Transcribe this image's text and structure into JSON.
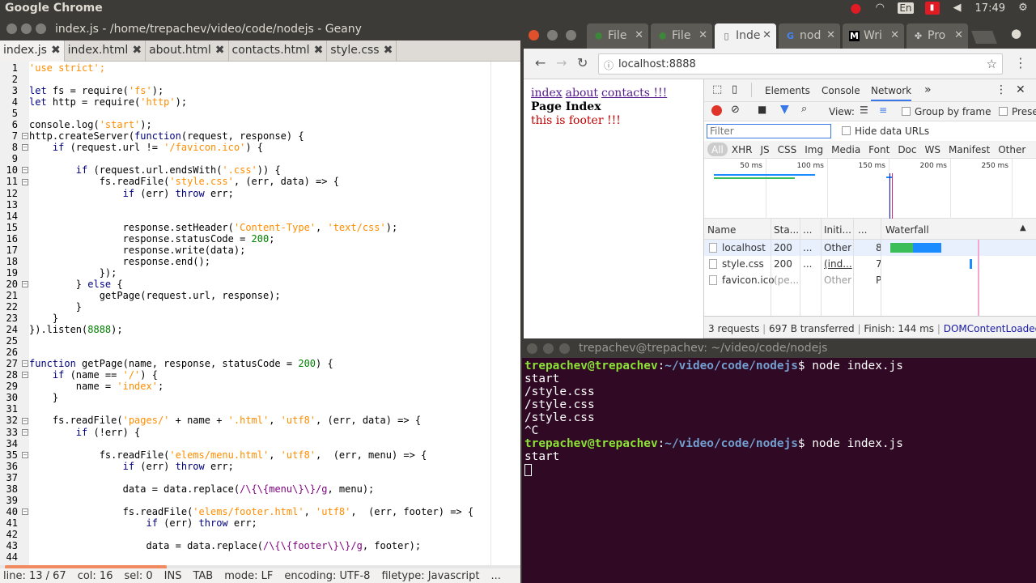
{
  "topbar": {
    "app_title": "Google Chrome",
    "lang": "En",
    "time": "17:49"
  },
  "geany": {
    "title": "index.js - /home/trepachev/video/code/nodejs - Geany",
    "tabs": [
      {
        "label": "index.js"
      },
      {
        "label": "index.html"
      },
      {
        "label": "about.html"
      },
      {
        "label": "contacts.html"
      },
      {
        "label": "style.css"
      }
    ],
    "code_lines": [
      [
        [
          "s",
          "'use strict';"
        ]
      ],
      [],
      [
        [
          "k",
          "let"
        ],
        [
          "t",
          " fs = require("
        ],
        [
          "s",
          "'fs'"
        ],
        [
          "t",
          ");"
        ]
      ],
      [
        [
          "k",
          "let"
        ],
        [
          "t",
          " http = require("
        ],
        [
          "s",
          "'http'"
        ],
        [
          "t",
          ");"
        ]
      ],
      [],
      [
        [
          "t",
          "console.log("
        ],
        [
          "s",
          "'start'"
        ],
        [
          "t",
          ");"
        ]
      ],
      [
        [
          "t",
          "http.createServer("
        ],
        [
          "k",
          "function"
        ],
        [
          "t",
          "(request, response) {"
        ]
      ],
      [
        [
          "t",
          "    "
        ],
        [
          "k",
          "if"
        ],
        [
          "t",
          " (request.url != "
        ],
        [
          "s",
          "'/favicon.ico'"
        ],
        [
          "t",
          ") {"
        ]
      ],
      [],
      [
        [
          "t",
          "        "
        ],
        [
          "k",
          "if"
        ],
        [
          "t",
          " (request.url.endsWith("
        ],
        [
          "s",
          "'.css'"
        ],
        [
          "t",
          ")) {"
        ]
      ],
      [
        [
          "t",
          "            fs.readFile("
        ],
        [
          "s",
          "'style.css'"
        ],
        [
          "t",
          ", (err, data) => {"
        ]
      ],
      [
        [
          "t",
          "                "
        ],
        [
          "k",
          "if"
        ],
        [
          "t",
          " (err) "
        ],
        [
          "k",
          "throw"
        ],
        [
          "t",
          " err;"
        ]
      ],
      [],
      [],
      [
        [
          "t",
          "                response.setHeader("
        ],
        [
          "s",
          "'Content-Type'"
        ],
        [
          "t",
          ", "
        ],
        [
          "s",
          "'text/css'"
        ],
        [
          "t",
          ");"
        ]
      ],
      [
        [
          "t",
          "                response.statusCode = "
        ],
        [
          "n",
          "200"
        ],
        [
          "t",
          ";"
        ]
      ],
      [
        [
          "t",
          "                response.write(data);"
        ]
      ],
      [
        [
          "t",
          "                response.end();"
        ]
      ],
      [
        [
          "t",
          "            });"
        ]
      ],
      [
        [
          "t",
          "        } "
        ],
        [
          "k",
          "else"
        ],
        [
          "t",
          " {"
        ]
      ],
      [
        [
          "t",
          "            getPage(request.url, response);"
        ]
      ],
      [
        [
          "t",
          "        }"
        ]
      ],
      [
        [
          "t",
          "    }"
        ]
      ],
      [
        [
          "t",
          "}).listen("
        ],
        [
          "n",
          "8888"
        ],
        [
          "t",
          ");"
        ]
      ],
      [],
      [],
      [
        [
          "k",
          "function"
        ],
        [
          "t",
          " getPage(name, response, statusCode = "
        ],
        [
          "n",
          "200"
        ],
        [
          "t",
          ") {"
        ]
      ],
      [
        [
          "t",
          "    "
        ],
        [
          "k",
          "if"
        ],
        [
          "t",
          " (name == "
        ],
        [
          "s",
          "'/'"
        ],
        [
          "t",
          ") {"
        ]
      ],
      [
        [
          "t",
          "        name = "
        ],
        [
          "s",
          "'index'"
        ],
        [
          "t",
          ";"
        ]
      ],
      [
        [
          "t",
          "    }"
        ]
      ],
      [],
      [
        [
          "t",
          "    fs.readFile("
        ],
        [
          "s",
          "'pages/'"
        ],
        [
          "t",
          " + name + "
        ],
        [
          "s",
          "'.html'"
        ],
        [
          "t",
          ", "
        ],
        [
          "s",
          "'utf8'"
        ],
        [
          "t",
          ", (err, data) => {"
        ]
      ],
      [
        [
          "t",
          "        "
        ],
        [
          "k",
          "if"
        ],
        [
          "t",
          " (!err) {"
        ]
      ],
      [],
      [
        [
          "t",
          "            fs.readFile("
        ],
        [
          "s",
          "'elems/menu.html'"
        ],
        [
          "t",
          ", "
        ],
        [
          "s",
          "'utf8'"
        ],
        [
          "t",
          ",  (err, menu) => {"
        ]
      ],
      [
        [
          "t",
          "                "
        ],
        [
          "k",
          "if"
        ],
        [
          "t",
          " (err) "
        ],
        [
          "k",
          "throw"
        ],
        [
          "t",
          " err;"
        ]
      ],
      [],
      [
        [
          "t",
          "                data = data.replace("
        ],
        [
          "r",
          "/\\{\\{menu\\}\\}/g"
        ],
        [
          "t",
          ", menu);"
        ]
      ],
      [],
      [
        [
          "t",
          "                fs.readFile("
        ],
        [
          "s",
          "'elems/footer.html'"
        ],
        [
          "t",
          ", "
        ],
        [
          "s",
          "'utf8'"
        ],
        [
          "t",
          ",  (err, footer) => {"
        ]
      ],
      [
        [
          "t",
          "                    "
        ],
        [
          "k",
          "if"
        ],
        [
          "t",
          " (err) "
        ],
        [
          "k",
          "throw"
        ],
        [
          "t",
          " err;"
        ]
      ],
      [],
      [
        [
          "t",
          "                    data = data.replace("
        ],
        [
          "r",
          "/\\{\\{footer\\}\\}/g"
        ],
        [
          "t",
          ", footer);"
        ]
      ],
      []
    ],
    "fold_lines": [
      7,
      8,
      10,
      11,
      20,
      27,
      28,
      32,
      33,
      35,
      40
    ],
    "status": {
      "line": "line: 13 / 67",
      "col": "col: 16",
      "sel": "sel: 0",
      "ins": "INS",
      "tab": "TAB",
      "mode": "mode: LF",
      "encoding": "encoding: UTF-8",
      "filetype": "filetype: Javascript",
      "more": "..."
    }
  },
  "chrome": {
    "tabs": [
      {
        "label": "File",
        "icon": "node-icon"
      },
      {
        "label": "File",
        "icon": "node-icon"
      },
      {
        "label": "Inde",
        "icon": "doc-icon"
      },
      {
        "label": "nod",
        "icon": "google-icon"
      },
      {
        "label": "Wri",
        "icon": "medium-icon"
      },
      {
        "label": "Pro",
        "icon": "puzzle-icon"
      }
    ],
    "url": "localhost:8888",
    "page": {
      "links": [
        "index",
        "about",
        "contacts !!!"
      ],
      "heading": "Page Index",
      "footer": "this is footer !!!"
    },
    "devtools": {
      "tabs": [
        "Elements",
        "Console",
        "Network"
      ],
      "view_label": "View:",
      "group_by_frame": "Group by frame",
      "preserve": "Prese",
      "filter_placeholder": "Filter",
      "hide_data_urls": "Hide data URLs",
      "types": [
        "All",
        "XHR",
        "JS",
        "CSS",
        "Img",
        "Media",
        "Font",
        "Doc",
        "WS",
        "Manifest",
        "Other"
      ],
      "ticks": [
        "50 ms",
        "100 ms",
        "150 ms",
        "200 ms",
        "250 ms"
      ],
      "columns": [
        "Name",
        "Sta...",
        "...",
        "Initi...",
        "...",
        "Waterfall"
      ],
      "rows": [
        {
          "name": "localhost",
          "status": "200",
          "type": "...",
          "initiator": "Other",
          "size": "8"
        },
        {
          "name": "style.css",
          "status": "200",
          "type": "...",
          "initiator": "(ind...",
          "size": "7"
        },
        {
          "name": "favicon.ico",
          "status": "(pe...",
          "type": "",
          "initiator": "Other",
          "size": "P"
        }
      ],
      "summary": {
        "requests": "3 requests",
        "transferred": "697 B transferred",
        "finish": "Finish: 144 ms",
        "dcl": "DOMContentLoaded: ..."
      }
    }
  },
  "terminal": {
    "title": "trepachev@trepachev: ~/video/code/nodejs",
    "user": "trepachev@trepachev",
    "path": "~/video/code/nodejs",
    "cmd1": "$ node index.js",
    "out": [
      "start",
      "/style.css",
      "/style.css",
      "/style.css",
      "^C"
    ],
    "cmd2": "$ node index.js",
    "out2": "start"
  },
  "colors": {
    "panel": "#3c3b37",
    "terminal_bg": "#300a24",
    "prompt_user": "#8ae234",
    "prompt_path": "#729fcf",
    "code_string": "#ff8d00",
    "code_keyword": "#00007f",
    "code_number": "#007f00",
    "code_regex": "#7f007f"
  }
}
